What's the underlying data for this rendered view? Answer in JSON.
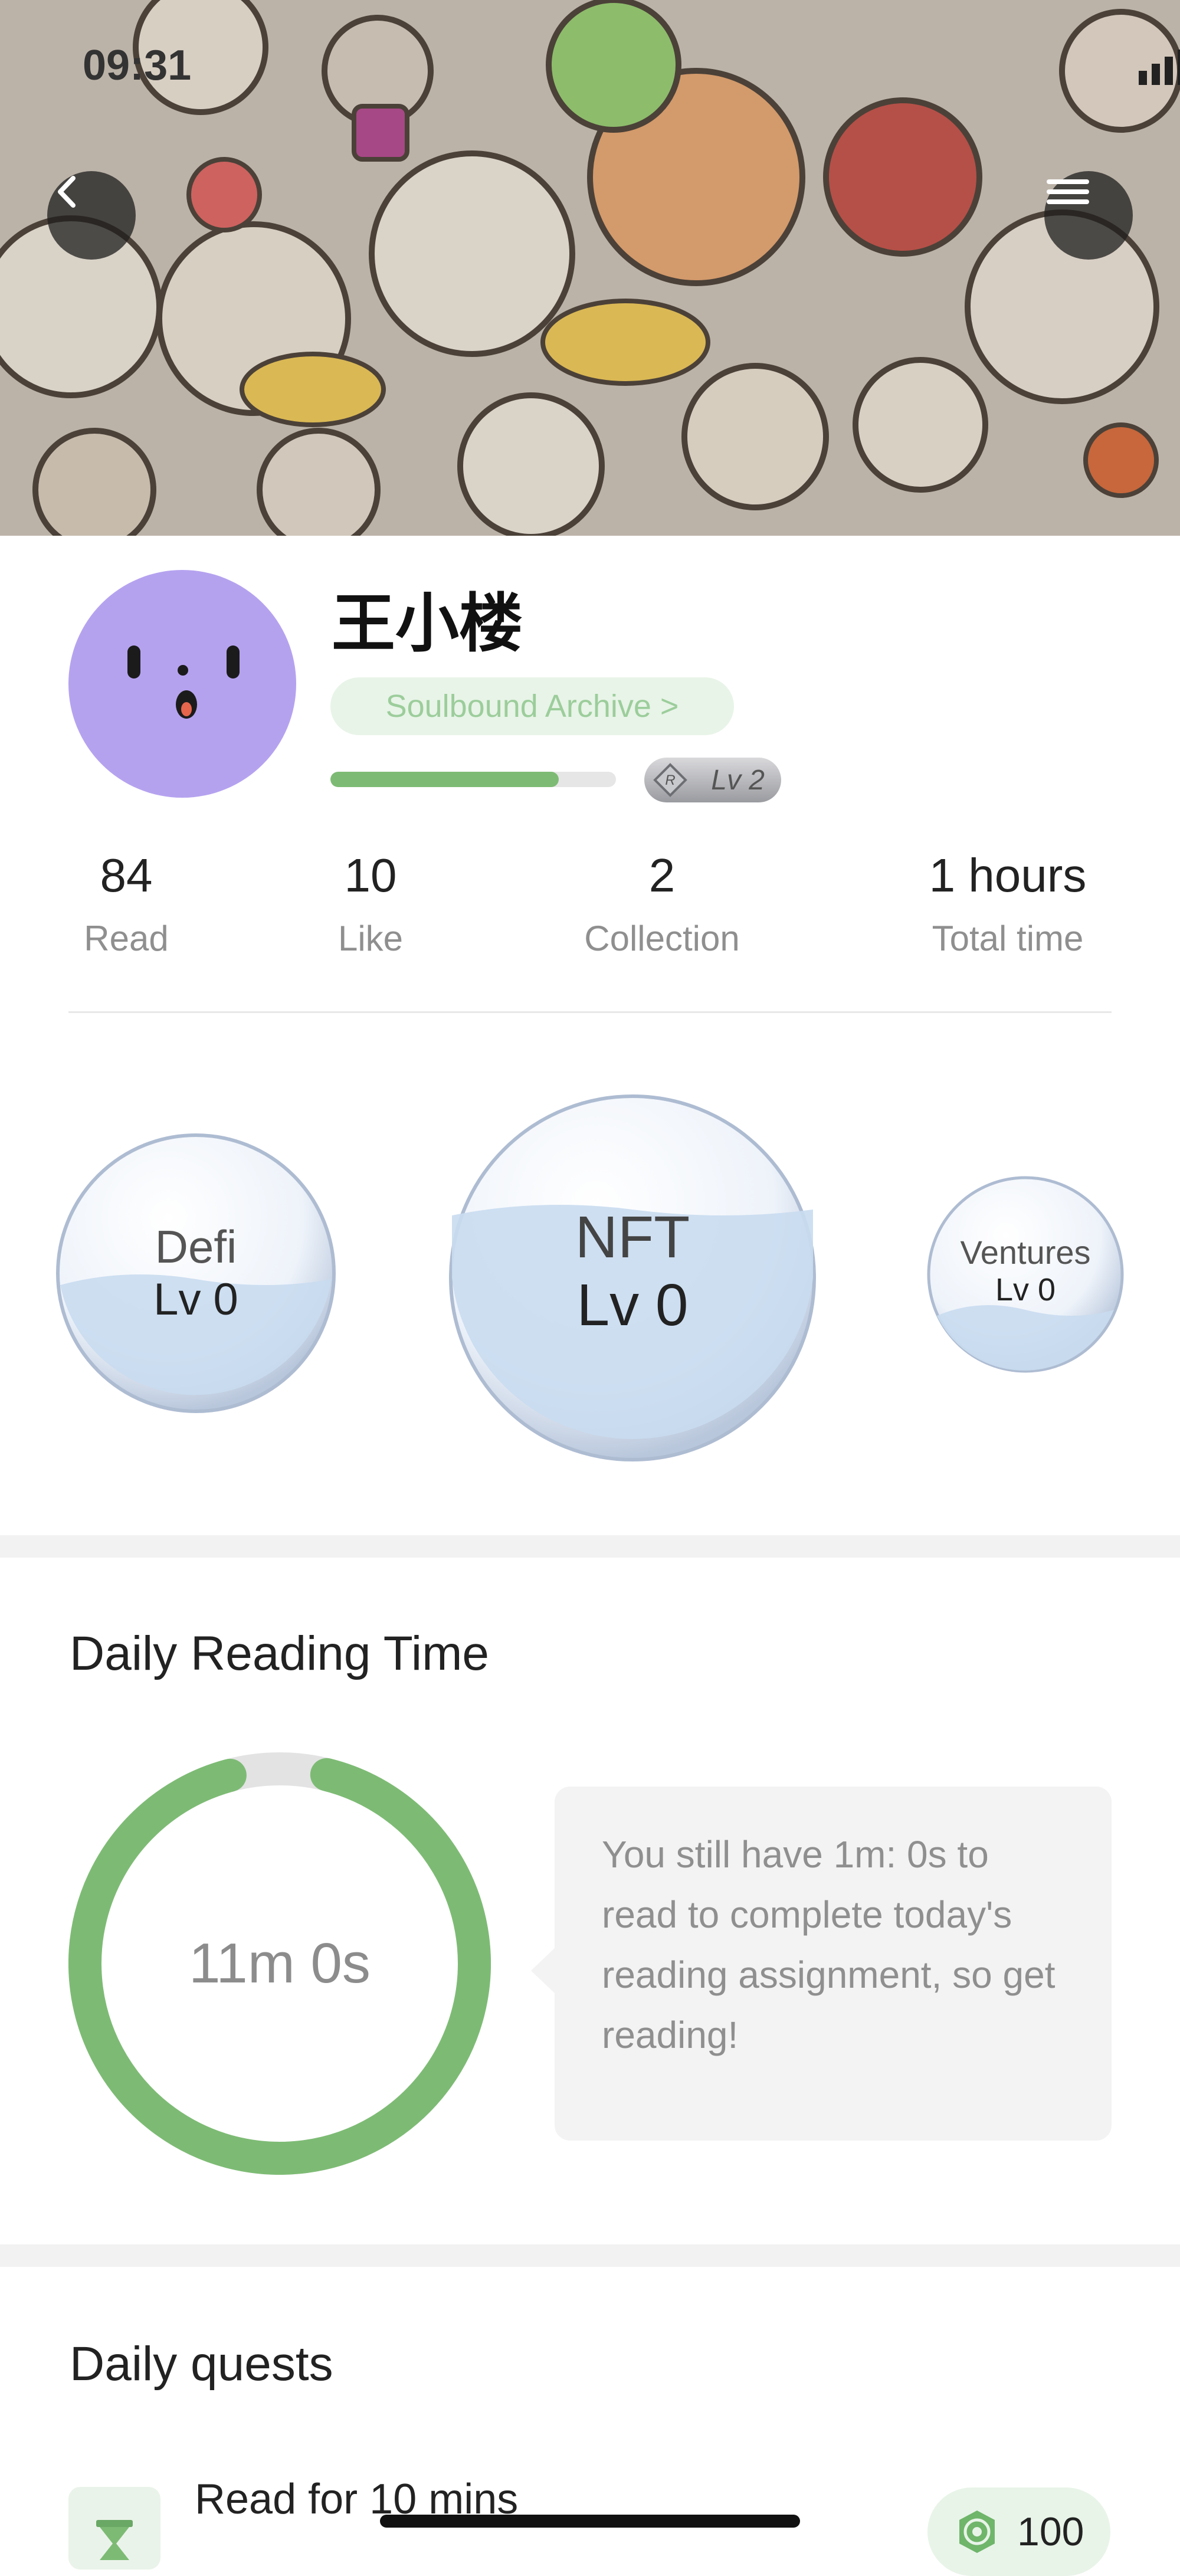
{
  "status_bar": {
    "time": "09:31"
  },
  "profile": {
    "username": "王小楼",
    "archive_link": "Soulbound Archive >",
    "level_badge": "Lv 2",
    "level_progress": 0.8
  },
  "stats": [
    {
      "value": "84",
      "label": "Read"
    },
    {
      "value": "10",
      "label": "Like"
    },
    {
      "value": "2",
      "label": "Collection"
    },
    {
      "value": "1 hours",
      "label": "Total time"
    }
  ],
  "bubbles": [
    {
      "name": "Defi",
      "level": "Lv 0"
    },
    {
      "name": "NFT",
      "level": "Lv 0"
    },
    {
      "name": "Ventures",
      "level": "Lv 0"
    }
  ],
  "daily_reading": {
    "title": "Daily Reading Time",
    "time_label": "11m 0s",
    "progress": 0.92,
    "message": "You still have 1m: 0s to read to complete today's reading assignment, so get reading!"
  },
  "daily_quests": {
    "title": "Daily quests",
    "items": [
      {
        "title": "Read for 10 mins",
        "reward": "100"
      }
    ]
  },
  "colors": {
    "accent_green": "#7dbb74",
    "avatar_purple": "#b5a2ef",
    "pill_green_bg": "#e8f4e8"
  },
  "icons": {
    "back": "chevron-left-icon",
    "menu": "hamburger-menu-icon",
    "quest": "hourglass-icon",
    "reward": "token-coin-icon"
  }
}
